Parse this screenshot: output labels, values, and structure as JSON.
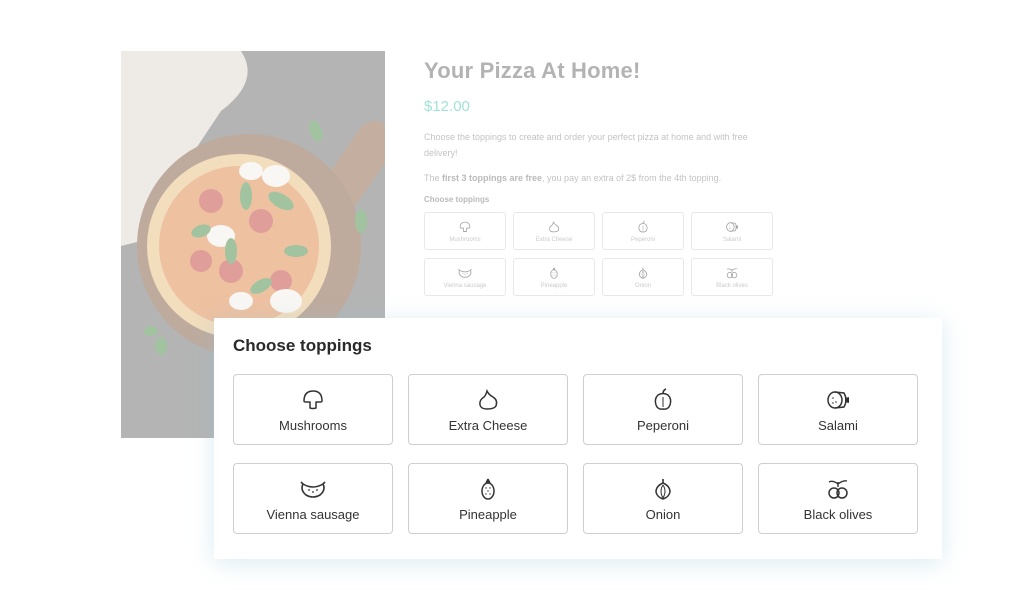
{
  "product": {
    "title": "Your Pizza At Home!",
    "price": "$12.00",
    "description": "Choose the toppings to create and order your perfect pizza at home and with free delivery!",
    "rule_prefix": "The ",
    "rule_bold": "first 3 toppings are free",
    "rule_suffix": ", you pay an extra of 2$ from the 4th topping.",
    "toppings_heading": "Choose toppings"
  },
  "image": {
    "alt": "Pizza on wooden board"
  },
  "panel": {
    "title": "Choose toppings"
  },
  "toppings": [
    {
      "label": "Mushrooms",
      "icon": "mushroom-icon"
    },
    {
      "label": "Extra Cheese",
      "icon": "cheese-icon"
    },
    {
      "label": "Peperoni",
      "icon": "pepper-icon"
    },
    {
      "label": "Salami",
      "icon": "salami-icon"
    },
    {
      "label": "Vienna sausage",
      "icon": "sausage-icon"
    },
    {
      "label": "Pineapple",
      "icon": "pineapple-icon"
    },
    {
      "label": "Onion",
      "icon": "onion-icon"
    },
    {
      "label": "Black olives",
      "icon": "olives-icon"
    }
  ],
  "colors": {
    "accent": "#2bbfa3",
    "text": "#2a2a2a",
    "border": "#cfcfcf"
  }
}
